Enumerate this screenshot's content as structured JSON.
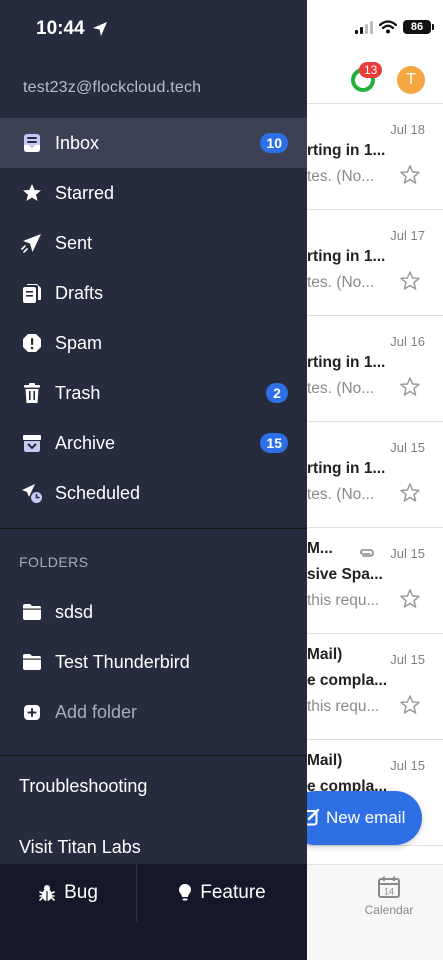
{
  "status_bar": {
    "time": "10:44",
    "battery": "86"
  },
  "header": {
    "notification_count": "13",
    "avatar_initial": "T"
  },
  "account": {
    "email": "test23z@flockcloud.tech"
  },
  "nav": [
    {
      "label": "Inbox",
      "icon": "inbox-icon",
      "badge": "10",
      "active": true
    },
    {
      "label": "Starred",
      "icon": "star-icon"
    },
    {
      "label": "Sent",
      "icon": "send-icon"
    },
    {
      "label": "Drafts",
      "icon": "drafts-icon"
    },
    {
      "label": "Spam",
      "icon": "spam-icon"
    },
    {
      "label": "Trash",
      "icon": "trash-icon",
      "badge": "2"
    },
    {
      "label": "Archive",
      "icon": "archive-icon",
      "badge": "15"
    },
    {
      "label": "Scheduled",
      "icon": "scheduled-icon"
    }
  ],
  "folders": {
    "header": "FOLDERS",
    "items": [
      {
        "label": "sdsd",
        "icon": "folder-icon"
      },
      {
        "label": "Test Thunderbird",
        "icon": "folder-icon"
      }
    ],
    "add_label": "Add folder"
  },
  "links": {
    "troubleshooting": "Troubleshooting",
    "visit_labs": "Visit Titan Labs"
  },
  "feedback": {
    "bug": "Bug",
    "feature": "Feature"
  },
  "emails": [
    {
      "date": "Jul 18",
      "subject": "rting in 1...",
      "preview": "tes. (No...",
      "attachment": false
    },
    {
      "date": "Jul 17",
      "subject": "rting in 1...",
      "preview": "tes. (No...",
      "attachment": false
    },
    {
      "date": "Jul 16",
      "subject": "rting in 1...",
      "preview": "tes. (No...",
      "attachment": false
    },
    {
      "date": "Jul 15",
      "subject": "rting in 1...",
      "preview": "tes. (No...",
      "attachment": false
    },
    {
      "date": "Jul 15",
      "sender": "M...",
      "subject": "sive Spa...",
      "preview": "this requ...",
      "attachment": true
    },
    {
      "date": "Jul 15",
      "sender": "Mail)",
      "subject": "e compla...",
      "preview": "this requ...",
      "attachment": false
    },
    {
      "date": "Jul 15",
      "sender": "Mail)",
      "subject": "e compla...",
      "preview": "",
      "attachment": false
    }
  ],
  "fab": {
    "label": "New email"
  },
  "bottom_tabs": {
    "calendar_label": "Calendar",
    "calendar_day": "14"
  }
}
